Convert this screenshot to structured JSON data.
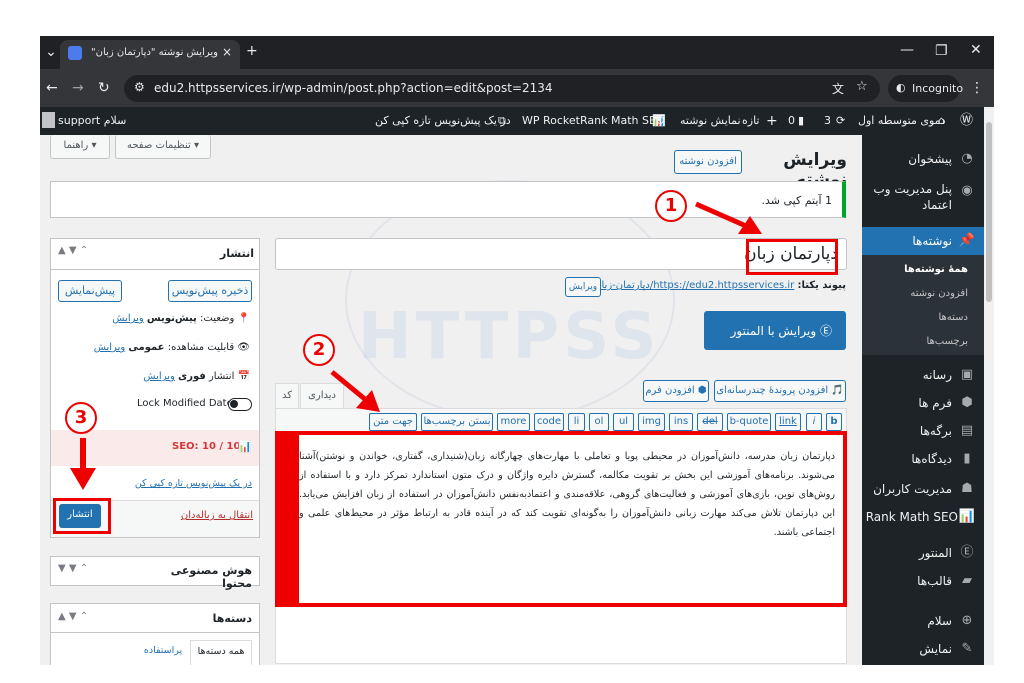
{
  "browser": {
    "tab_title": "ویرایش نوشته \"دپارتمان زبان\" ‹ د…",
    "url": "edu2.httpsservices.ir/wp-admin/post.php?action=edit&post=2134",
    "incognito": "Incognito"
  },
  "adminbar": {
    "site": "دموی متوسطه اول",
    "updates": "3",
    "comments": "0",
    "new": "تازه",
    "view_post": "نمایش نوشته",
    "rankmath": "Rank Math SEO",
    "wprocket": "WP Rocket",
    "copy_draft": "در یک پیش‌نویس تازه کپی کن",
    "greeting": "سلام support"
  },
  "menu": {
    "dashboard": "پیشخوان",
    "panel": "پنل مدیریت وب اعتماد",
    "posts": "نوشته‌ها",
    "sub_all": "همهٔ نوشته‌ها",
    "sub_add": "افزودن نوشته",
    "sub_cats": "دسته‌ها",
    "sub_tags": "برچسب‌ها",
    "media": "رسانه",
    "forms": "فرم ها",
    "pages": "برگه‌ها",
    "comments": "دیدگاه‌ها",
    "users_mgmt": "مدیریت کاربران",
    "rankmath": "Rank Math SEO",
    "elementor": "المنتور",
    "templates": "قالب‌ها",
    "hello": "سلام",
    "appearance": "نمایش"
  },
  "screen": {
    "options": "تنظیمات صفحه ▾",
    "help": "راهنما ▾"
  },
  "editor": {
    "heading": "ویرایش نوشته",
    "add_new": "افزودن نوشته",
    "notice": "1 آیتم کپی شد.",
    "title": "دپارتمان زبان",
    "permalink_label": "پیوند یکتا:",
    "permalink_url": "https://edu2.httpsservices.ir/دپارتمان-زبان-2/",
    "edit": "ویرایش",
    "elementor_btn": "ویرایش با المنتور",
    "add_media": "افزودن پروندهٔ چندرسانه‌ای",
    "add_form": "افزودن فرم",
    "tab_visual": "دیداری",
    "tab_code": "کد",
    "toolbar": [
      "b",
      "i",
      "link",
      "b-quote",
      "del",
      "ins",
      "img",
      "ul",
      "ol",
      "li",
      "code",
      "more",
      "بستن برچسب‌ها",
      "جهت متن"
    ],
    "body": "دپارتمان زبان مدرسه، دانش‌آموزان در محیطی پویا و تعاملی با مهارت‌های چهارگانه زبان(شنیداری، گفتاری، خواندن و نوشتن)آشنا می‌شوند. برنامه‌های آموزشی این بخش بر تقویت مکالمه، گسترش دایره واژگان و درک متون استاندارد تمرکز دارد و با استفاده از روش‌های نوین، بازی‌های آموزشی و فعالیت‌های گروهی، علاقه‌مندی و اعتمادبه‌نفس دانش‌آموزان در استفاده از زبان افزایش می‌یابد. این دپارتمان تلاش می‌کند مهارت زبانی دانش‌آموزان را به‌گونه‌ای تقویت کند که در آینده قادر به ارتباط مؤثر در محیط‌های علمی و اجتماعی باشند."
  },
  "publish": {
    "title": "انتشار",
    "save_draft": "ذخیره پیش‌نویس",
    "preview": "پیش‌نمایش",
    "status_label": "وضعیت:",
    "status_value": "پیش‌نویس",
    "visibility_label": "قابلیت مشاهده:",
    "visibility_value": "عمومی",
    "schedule_label": "انتشار",
    "schedule_value": "فوری",
    "edit": "ویرایش",
    "lock_modified": "Lock Modified Date",
    "seo": "SEO: 10 / 100",
    "copy_draft": "در یک پیش‌نویس تازه کپی کن",
    "trash": "انتقال به زباله‌دان",
    "publish_btn": "انتشار"
  },
  "ai_box": {
    "title": "هوش مصنوعی محتوا"
  },
  "cats_box": {
    "title": "دسته‌ها",
    "tab_all": "همه دسته‌ها",
    "tab_popular": "پراستفاده"
  },
  "annotations": {
    "one": "1",
    "two": "2",
    "three": "3"
  },
  "watermark": "HTTPSS",
  "colors": {
    "admin_dark": "#1d2327",
    "wp_blue": "#2271b1",
    "active_menu": "#2271b1",
    "annotation_red": "#e00000"
  }
}
